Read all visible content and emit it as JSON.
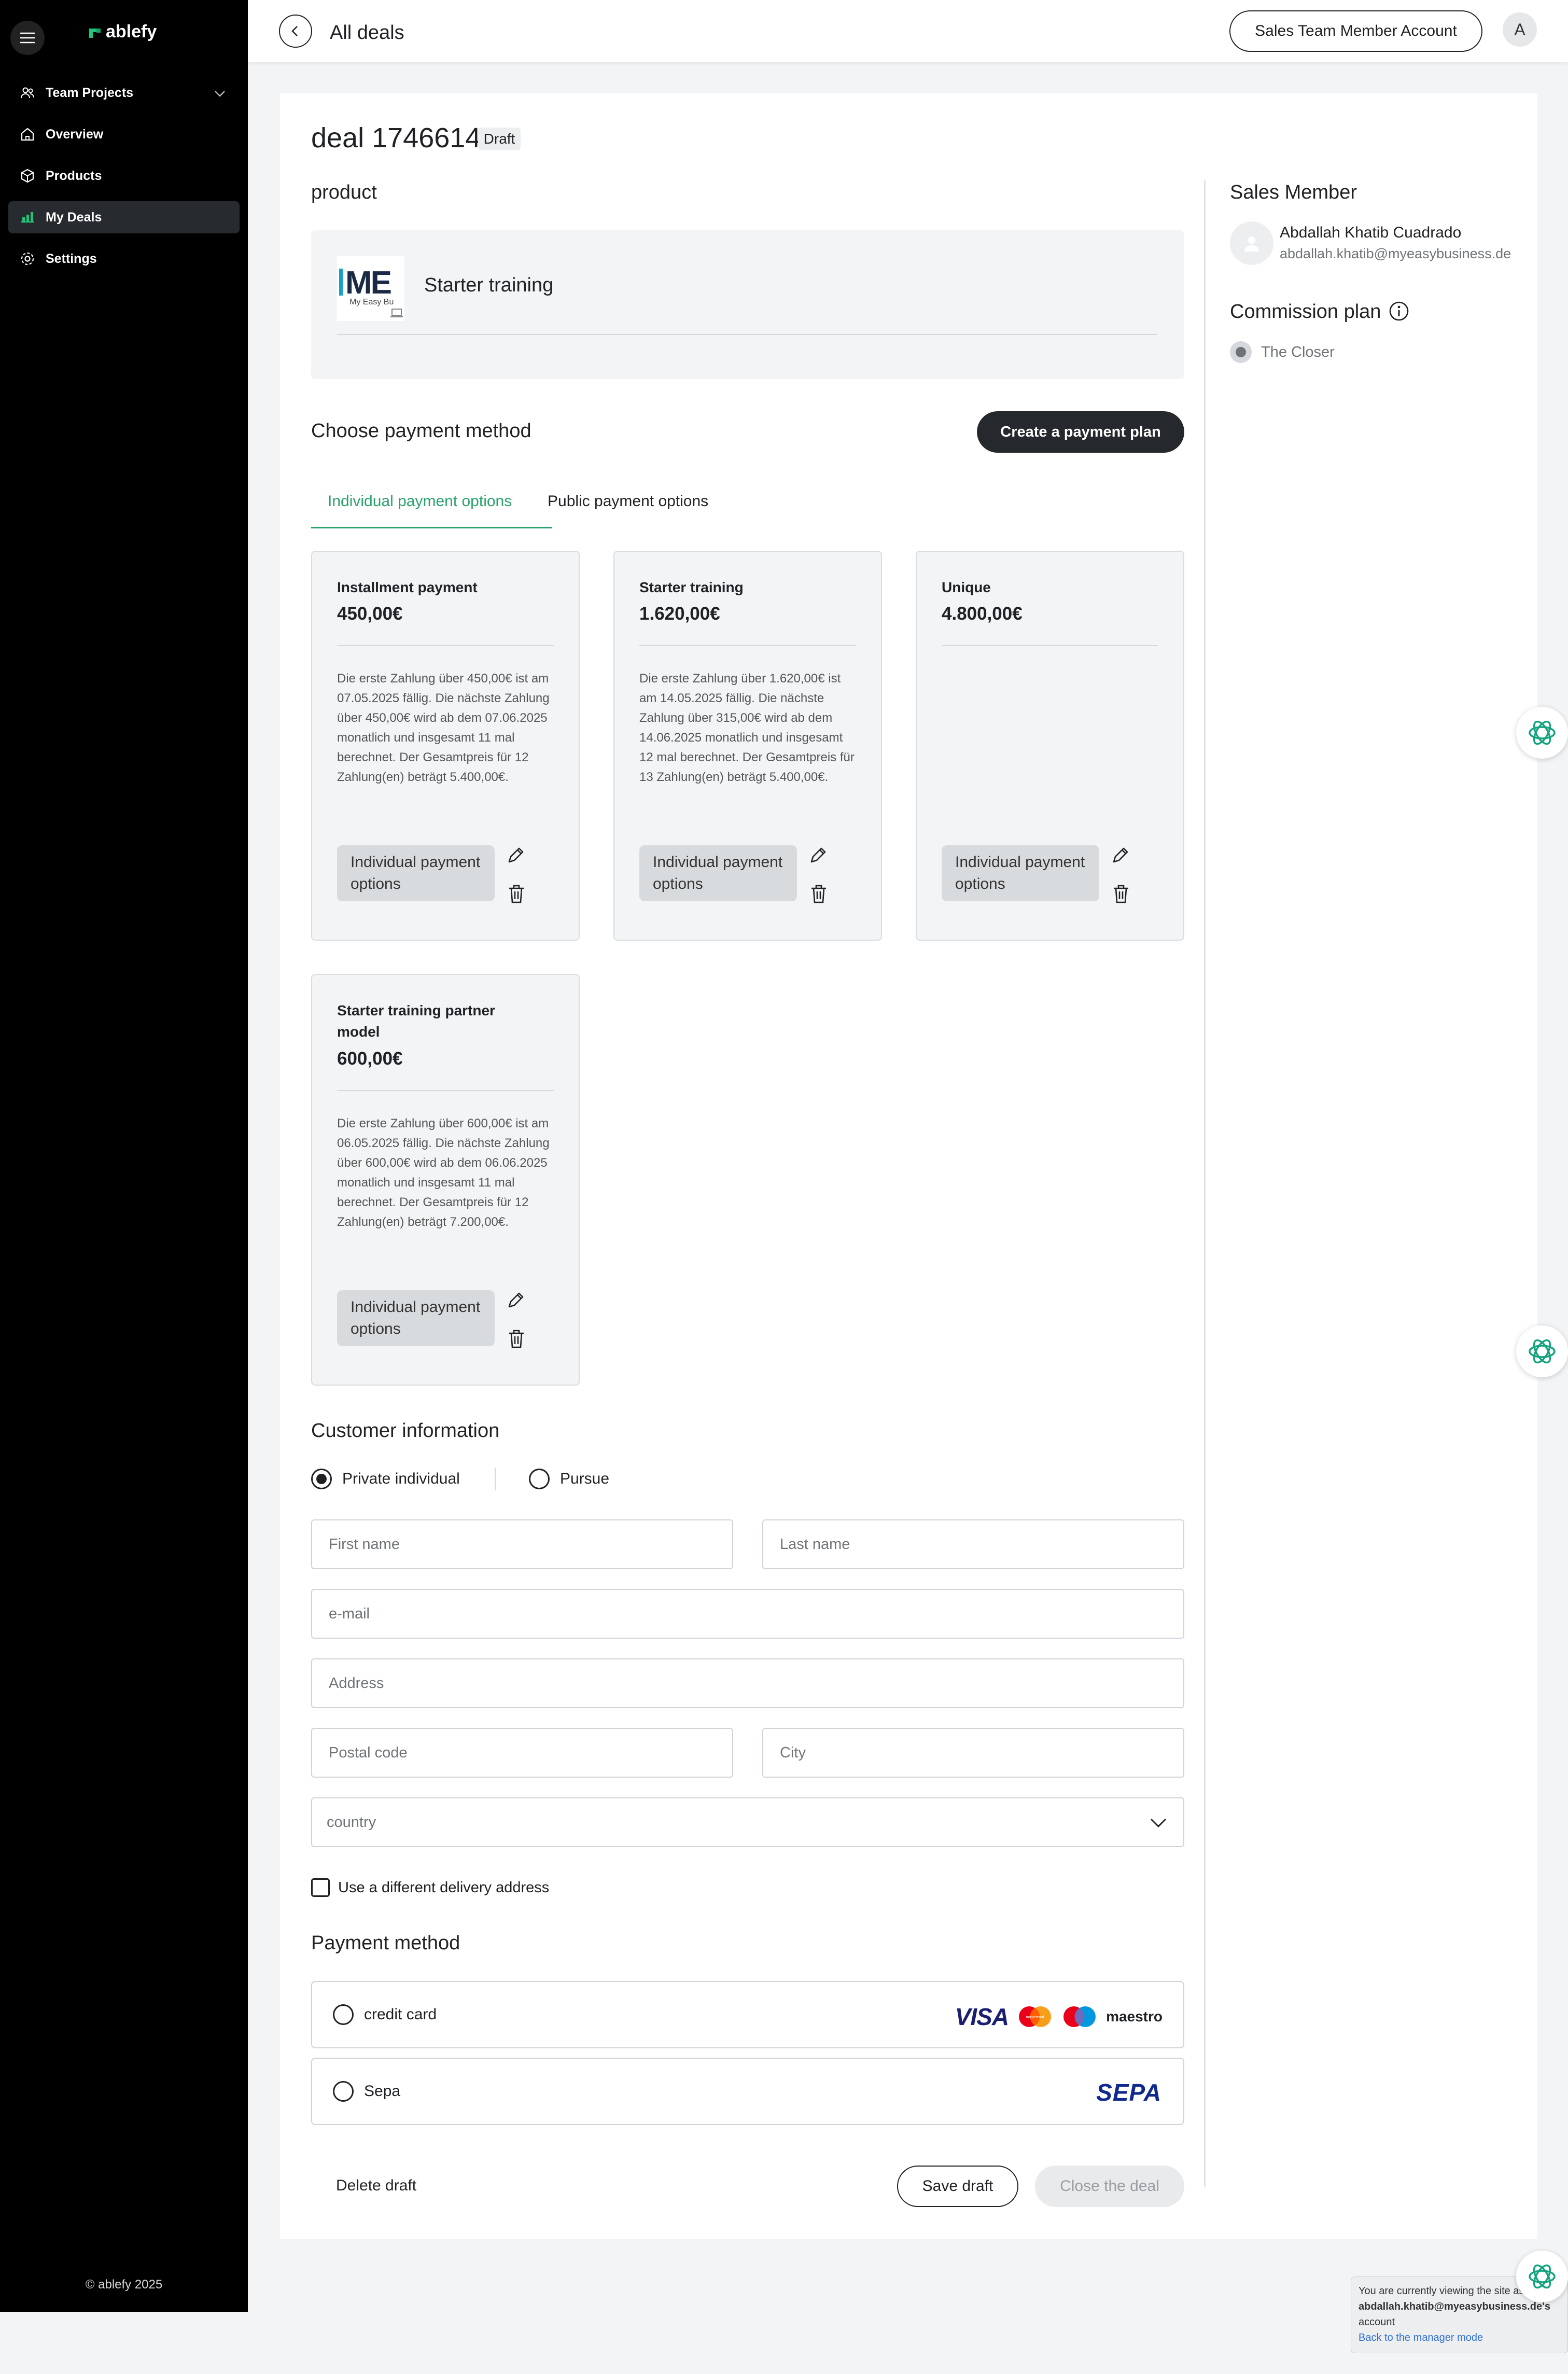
{
  "app": {
    "name": "ablefy"
  },
  "sidebar": {
    "items": [
      {
        "label": "Team Projects",
        "icon": "team-icon"
      },
      {
        "label": "Overview",
        "icon": "home-icon"
      },
      {
        "label": "Products",
        "icon": "box-icon"
      },
      {
        "label": "My Deals",
        "icon": "deals-icon",
        "active": true
      },
      {
        "label": "Settings",
        "icon": "gear-icon"
      }
    ],
    "copyright": "© ablefy 2025"
  },
  "header": {
    "title": "All deals",
    "account_button": "Sales Team Member Account",
    "avatar_initial": "A"
  },
  "deal": {
    "title": "deal 1746614",
    "status": "Draft"
  },
  "product": {
    "heading": "product",
    "name": "Starter training",
    "logo_text": "ME",
    "logo_subtext": "My Easy Bu"
  },
  "payment_choice": {
    "heading": "Choose payment method",
    "create_button": "Create a payment plan",
    "tabs": [
      {
        "label": "Individual payment options",
        "active": true
      },
      {
        "label": "Public payment options",
        "active": false
      }
    ],
    "options": [
      {
        "title": "Installment payment",
        "price": "450,00€",
        "description": "Die erste Zahlung über 450,00€ ist am 07.05.2025 fällig.   Die nächste Zahlung über 450,00€ wird ab dem 07.06.2025 monatlich und insgesamt 11 mal berechnet. Der Gesamtpreis für 12 Zahlung(en) beträgt 5.400,00€.",
        "tag": "Individual payment options"
      },
      {
        "title": "Starter training",
        "price": "1.620,00€",
        "description": "Die erste Zahlung über 1.620,00€ ist am 14.05.2025 fällig.   Die nächste Zahlung über 315,00€ wird ab dem 14.06.2025 monatlich und insgesamt 12 mal berechnet. Der Gesamtpreis für 13 Zahlung(en) beträgt 5.400,00€.",
        "tag": "Individual payment options"
      },
      {
        "title": "Unique",
        "price": "4.800,00€",
        "description": "",
        "tag": "Individual payment options"
      },
      {
        "title": "Starter training partner model",
        "price": "600,00€",
        "description": "Die erste Zahlung über 600,00€ ist am 06.05.2025 fällig.   Die nächste Zahlung über 600,00€ wird ab dem 06.06.2025 monatlich und insgesamt 11 mal berechnet. Der Gesamtpreis für 12 Zahlung(en) beträgt 7.200,00€.",
        "tag": "Individual payment options"
      }
    ]
  },
  "customer": {
    "heading": "Customer information",
    "type_options": [
      {
        "label": "Private individual",
        "selected": true
      },
      {
        "label": "Pursue",
        "selected": false
      }
    ],
    "fields": {
      "first_name": "First name",
      "last_name": "Last name",
      "email": "e-mail",
      "address": "Address",
      "postal_code": "Postal code",
      "city": "City",
      "country": "country"
    },
    "delivery_checkbox": "Use a different delivery address"
  },
  "payment_method": {
    "heading": "Payment method",
    "options": [
      {
        "label": "credit card",
        "logos": [
          "VISA",
          "mastercard",
          "maestro"
        ]
      },
      {
        "label": "Sepa",
        "logo": "SEPA"
      }
    ]
  },
  "actions": {
    "delete": "Delete draft",
    "save": "Save draft",
    "close": "Close the deal"
  },
  "sales_member": {
    "heading": "Sales Member",
    "name": "Abdallah Khatib Cuadrado",
    "email": "abdallah.khatib@myeasybusiness.de"
  },
  "commission": {
    "heading": "Commission plan",
    "plan": "The Closer"
  },
  "notice": {
    "line1": "You are currently viewing the site as",
    "account": "abdallah.khatib@myeasybusiness.de's",
    "line3": "account",
    "link": "Back to the manager mode"
  },
  "colors": {
    "accent": "#2aa36a",
    "sidebar_bg": "#000000",
    "primary_button": "#25282c"
  }
}
